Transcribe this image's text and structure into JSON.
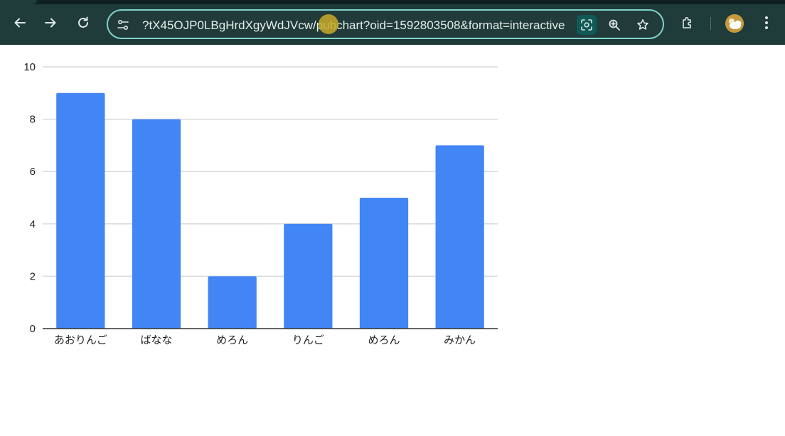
{
  "browser": {
    "url": "?tX45OJP0LBgHrdXgyWdJVcw/pubchart?oid=1592803508&format=interactive",
    "icons": {
      "back": "arrow-left",
      "forward": "arrow-right",
      "reload": "refresh",
      "site_info": "tune-settings",
      "lens": "google-lens",
      "zoom": "zoom-in",
      "bookmark": "star",
      "extensions": "puzzle-piece",
      "profile": "avatar",
      "menu": "three-dots-vertical"
    },
    "accent_color": "#7fd3c8"
  },
  "chart_data": {
    "type": "bar",
    "categories": [
      "あおりんご",
      "ばなな",
      "めろん",
      "りんご",
      "めろん",
      "みかん"
    ],
    "values": [
      9,
      8,
      2,
      4,
      5,
      7
    ],
    "ylim": [
      0,
      10
    ],
    "yticks": [
      "0",
      "2",
      "4",
      "6",
      "8",
      "10"
    ],
    "title": "",
    "xlabel": "",
    "ylabel": "",
    "grid": true,
    "bar_color": "#4285f4"
  }
}
